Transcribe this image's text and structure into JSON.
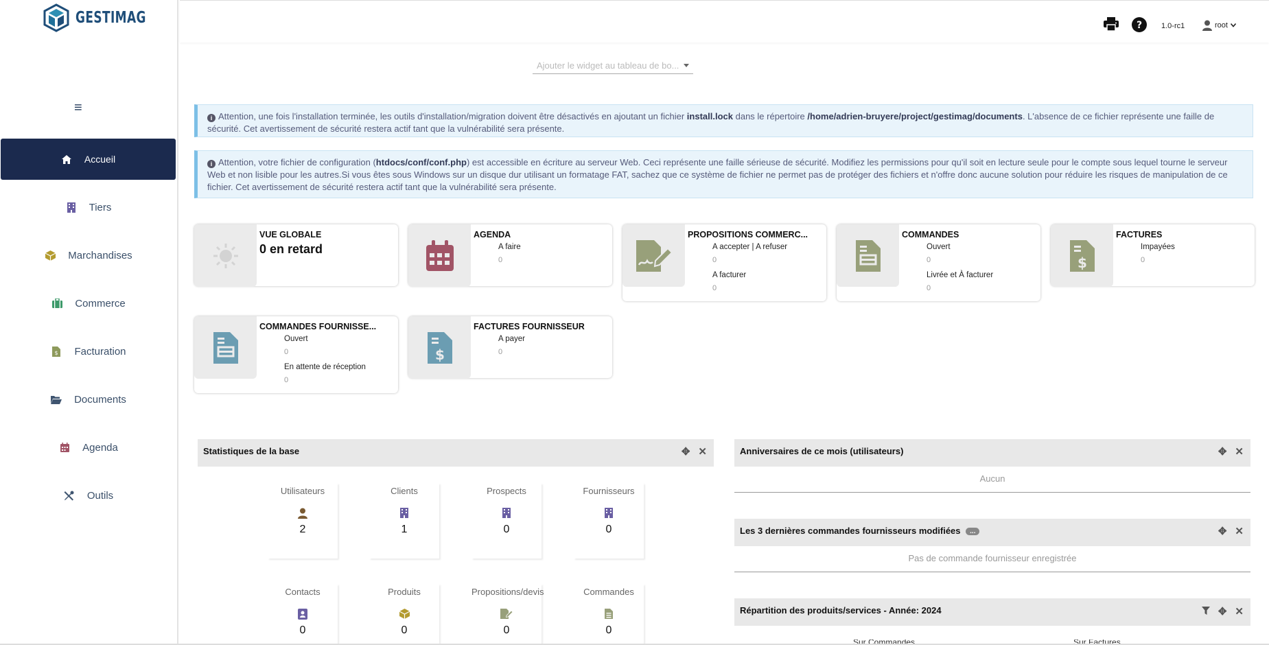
{
  "app": {
    "name": "GESTIMAG"
  },
  "colors": {
    "sidebar_active": "#1b2a4e",
    "alert_bg": "#e9f4fb",
    "box_icon_bg": "#ebebeb",
    "panel_head": "#e8e8e8"
  },
  "sidebar": {
    "items": [
      {
        "label": "Accueil",
        "icon": "home-icon",
        "active": true
      },
      {
        "label": "Tiers",
        "icon": "building-icon"
      },
      {
        "label": "Marchandises",
        "icon": "cube-icon"
      },
      {
        "label": "Commerce",
        "icon": "suitcase-icon"
      },
      {
        "label": "Facturation",
        "icon": "invoice-icon"
      },
      {
        "label": "Documents",
        "icon": "folder-open-icon"
      },
      {
        "label": "Agenda",
        "icon": "calendar-icon"
      },
      {
        "label": "Outils",
        "icon": "tools-icon"
      }
    ]
  },
  "topbar": {
    "version": "1.0-rc1",
    "user": "root"
  },
  "widget_select": {
    "placeholder": "Ajouter le widget au tableau de bo..."
  },
  "alerts": {
    "a1": {
      "p1": "Attention, une fois l'installation terminée, les outils d'installation/migration doivent être désactivés en ajoutant un fichier ",
      "b1": "install.lock",
      "p2": " dans le répertoire ",
      "b2": "/home/adrien-bruyere/project/gestimag/documents",
      "p3": ". L'absence de ce fichier représente une faille de sécurité. Cet avertissement de sécurité restera actif tant que la vulnérabilité sera présente."
    },
    "a2": {
      "p1": "Attention, votre fichier de configuration (",
      "b1": "htdocs/conf/conf.php",
      "p2": ") est accessible en écriture au serveur Web. Ceci représente une faille sérieuse de sécurité. Modifiez les permissions pour qu'il soit en lecture seule pour le compte sous lequel tourne le serveur Web et non lisible pour les autres.Si vous êtes sous Windows sur un disque dur utilisant un formatage FAT, sachez que ce système de fichier ne permet pas de protéger des fichiers et n'offre donc aucune solution pour réduire les risques de manipulation de ce fichier. Cet avertissement de sécurité restera actif tant que la vulnérabilité sera présente."
    }
  },
  "boxes": {
    "vue": {
      "title": "VUE GLOBALE",
      "value": "0 en retard"
    },
    "agenda": {
      "title": "AGENDA",
      "l1": "A faire",
      "v1": "0"
    },
    "props": {
      "title": "PROPOSITIONS COMMERC...",
      "l1": "A accepter | A refuser",
      "v1": "0",
      "l2": "A facturer",
      "v2": "0"
    },
    "commandes": {
      "title": "COMMANDES",
      "l1": "Ouvert",
      "v1": "0",
      "l2": "Livrée et À facturer",
      "v2": "0"
    },
    "factures": {
      "title": "FACTURES",
      "l1": "Impayées",
      "v1": "0"
    },
    "cmdfourn": {
      "title": "COMMANDES FOURNISSE...",
      "l1": "Ouvert",
      "v1": "0",
      "l2": "En attente de réception",
      "v2": "0"
    },
    "factfourn": {
      "title": "FACTURES FOURNISSEUR",
      "l1": "A payer",
      "v1": "0"
    }
  },
  "stats_panel": {
    "title": "Statistiques de la base",
    "items": [
      {
        "label": "Utilisateurs",
        "value": "2",
        "icon": "user-icon"
      },
      {
        "label": "Clients",
        "value": "1",
        "icon": "building-icon"
      },
      {
        "label": "Prospects",
        "value": "0",
        "icon": "building-icon"
      },
      {
        "label": "Fournisseurs",
        "value": "0",
        "icon": "building-icon"
      },
      {
        "label": "Contacts",
        "value": "0",
        "icon": "address-book-icon"
      },
      {
        "label": "Produits",
        "value": "0",
        "icon": "cube-icon"
      },
      {
        "label": "Propositions/devis",
        "value": "0",
        "icon": "signature-icon"
      },
      {
        "label": "Commandes",
        "value": "0",
        "icon": "file-icon"
      }
    ]
  },
  "birthday_panel": {
    "title": "Anniversaires de ce mois (utilisateurs)",
    "empty": "Aucun"
  },
  "supplier_orders_panel": {
    "title": "Les 3 dernières commandes fournisseurs modifiées",
    "badge": "...",
    "empty": "Pas de commande fournisseur enregistrée"
  },
  "repartition_panel": {
    "title": "Répartition des produits/services - Année: 2024",
    "col1": "Sur Commandes",
    "col2": "Sur Factures"
  }
}
